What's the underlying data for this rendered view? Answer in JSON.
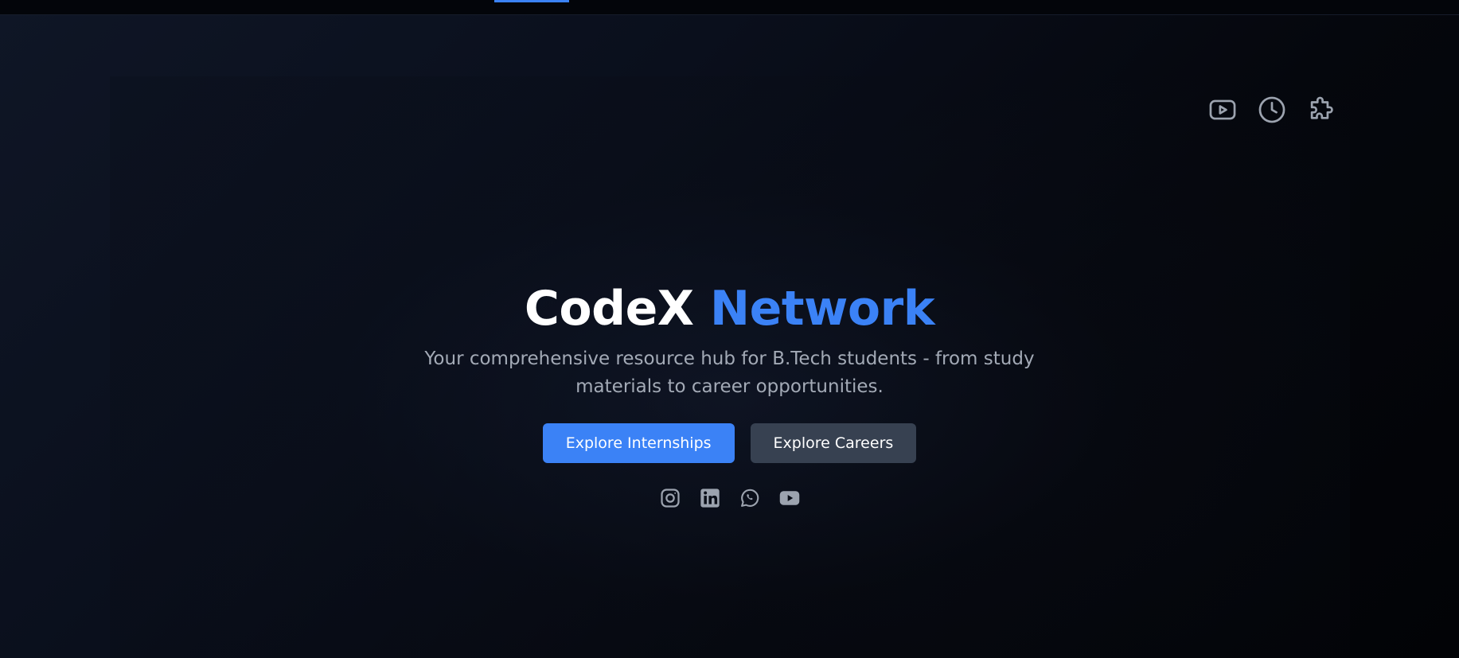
{
  "hero": {
    "title_part1": "CodeX",
    "title_part2": "Network",
    "subtitle": "Your comprehensive resource hub for B.Tech students - from study materials to career opportunities."
  },
  "buttons": {
    "internships": "Explore Internships",
    "careers": "Explore Careers"
  },
  "top_icons": [
    "youtube-icon",
    "clock-icon",
    "puzzle-icon"
  ],
  "social_icons": [
    "instagram-icon",
    "linkedin-icon",
    "whatsapp-icon",
    "youtube-icon"
  ],
  "colors": {
    "accent": "#3b82f6",
    "secondary_button": "#374151",
    "subtitle_text": "#a3aab6",
    "icon_gray": "#9ca3af",
    "background": "#050812"
  }
}
